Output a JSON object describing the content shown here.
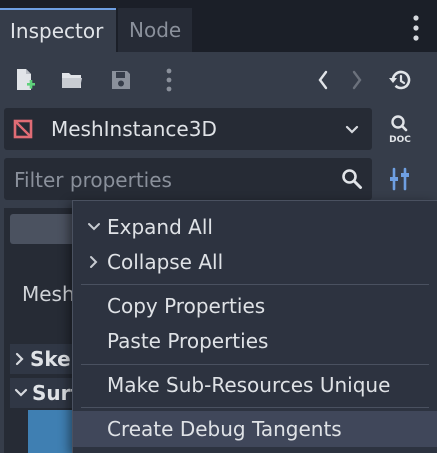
{
  "tabs": [
    {
      "label": "Inspector",
      "active": true
    },
    {
      "label": "Node",
      "active": false
    }
  ],
  "toolbar": {
    "icons": [
      "new-resource-icon",
      "open-folder-icon",
      "save-icon",
      "more-icon",
      "back-icon",
      "forward-icon",
      "history-icon"
    ]
  },
  "node_select": {
    "name": "MeshInstance3D",
    "doc_label": "DOC"
  },
  "filter": {
    "placeholder": "Filter properties"
  },
  "inspector": {
    "mesh_label": "Mesh",
    "sections": [
      "Skel",
      "Surf"
    ]
  },
  "context_menu": {
    "items": [
      {
        "label": "Expand All",
        "chevron": "down"
      },
      {
        "label": "Collapse All",
        "chevron": "right"
      },
      {
        "label": "Copy Properties"
      },
      {
        "label": "Paste Properties"
      },
      {
        "label": "Make Sub-Resources Unique"
      },
      {
        "label": "Create Debug Tangents",
        "hovered": true
      }
    ]
  },
  "colors": {
    "accent": "#6e9fe2",
    "node_icon": "#e06c75",
    "panel": "#363d4a",
    "menu": "#2d3340"
  }
}
